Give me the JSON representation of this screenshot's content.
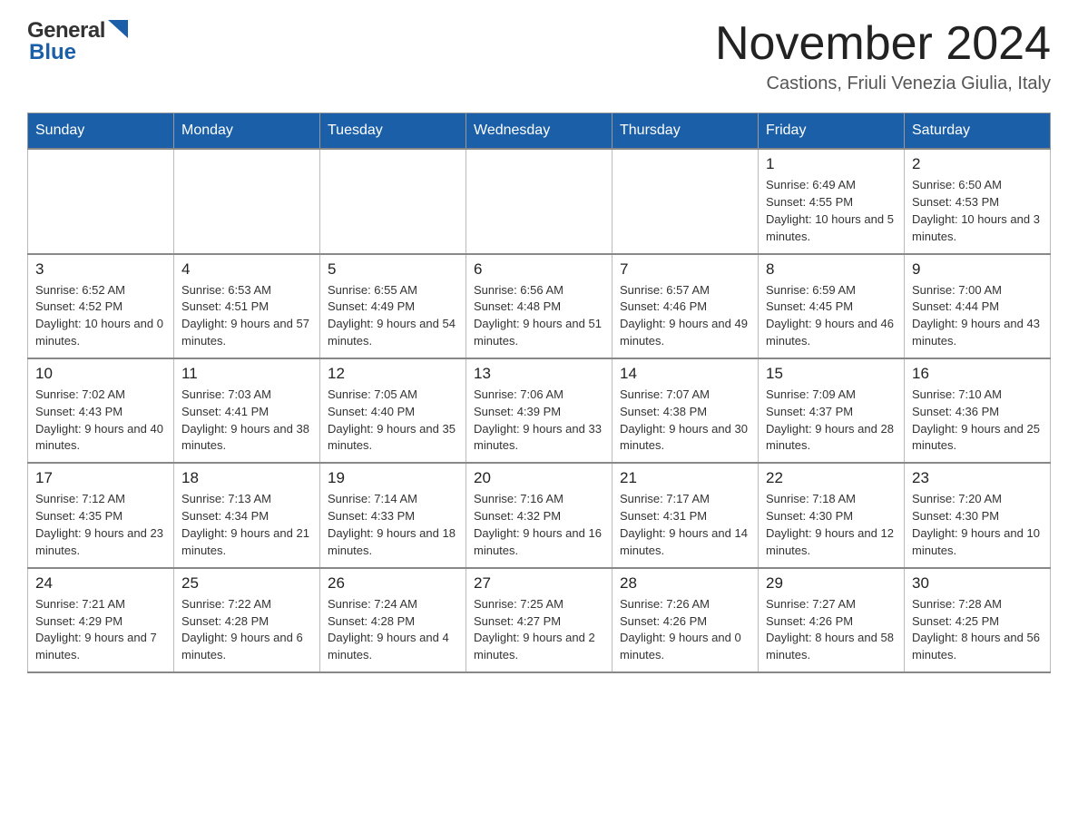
{
  "header": {
    "logo_general": "General",
    "logo_blue": "Blue",
    "month_title": "November 2024",
    "location": "Castions, Friuli Venezia Giulia, Italy"
  },
  "weekdays": [
    "Sunday",
    "Monday",
    "Tuesday",
    "Wednesday",
    "Thursday",
    "Friday",
    "Saturday"
  ],
  "rows": [
    {
      "days": [
        {
          "num": "",
          "info": ""
        },
        {
          "num": "",
          "info": ""
        },
        {
          "num": "",
          "info": ""
        },
        {
          "num": "",
          "info": ""
        },
        {
          "num": "",
          "info": ""
        },
        {
          "num": "1",
          "info": "Sunrise: 6:49 AM\nSunset: 4:55 PM\nDaylight: 10 hours and 5 minutes."
        },
        {
          "num": "2",
          "info": "Sunrise: 6:50 AM\nSunset: 4:53 PM\nDaylight: 10 hours and 3 minutes."
        }
      ]
    },
    {
      "days": [
        {
          "num": "3",
          "info": "Sunrise: 6:52 AM\nSunset: 4:52 PM\nDaylight: 10 hours and 0 minutes."
        },
        {
          "num": "4",
          "info": "Sunrise: 6:53 AM\nSunset: 4:51 PM\nDaylight: 9 hours and 57 minutes."
        },
        {
          "num": "5",
          "info": "Sunrise: 6:55 AM\nSunset: 4:49 PM\nDaylight: 9 hours and 54 minutes."
        },
        {
          "num": "6",
          "info": "Sunrise: 6:56 AM\nSunset: 4:48 PM\nDaylight: 9 hours and 51 minutes."
        },
        {
          "num": "7",
          "info": "Sunrise: 6:57 AM\nSunset: 4:46 PM\nDaylight: 9 hours and 49 minutes."
        },
        {
          "num": "8",
          "info": "Sunrise: 6:59 AM\nSunset: 4:45 PM\nDaylight: 9 hours and 46 minutes."
        },
        {
          "num": "9",
          "info": "Sunrise: 7:00 AM\nSunset: 4:44 PM\nDaylight: 9 hours and 43 minutes."
        }
      ]
    },
    {
      "days": [
        {
          "num": "10",
          "info": "Sunrise: 7:02 AM\nSunset: 4:43 PM\nDaylight: 9 hours and 40 minutes."
        },
        {
          "num": "11",
          "info": "Sunrise: 7:03 AM\nSunset: 4:41 PM\nDaylight: 9 hours and 38 minutes."
        },
        {
          "num": "12",
          "info": "Sunrise: 7:05 AM\nSunset: 4:40 PM\nDaylight: 9 hours and 35 minutes."
        },
        {
          "num": "13",
          "info": "Sunrise: 7:06 AM\nSunset: 4:39 PM\nDaylight: 9 hours and 33 minutes."
        },
        {
          "num": "14",
          "info": "Sunrise: 7:07 AM\nSunset: 4:38 PM\nDaylight: 9 hours and 30 minutes."
        },
        {
          "num": "15",
          "info": "Sunrise: 7:09 AM\nSunset: 4:37 PM\nDaylight: 9 hours and 28 minutes."
        },
        {
          "num": "16",
          "info": "Sunrise: 7:10 AM\nSunset: 4:36 PM\nDaylight: 9 hours and 25 minutes."
        }
      ]
    },
    {
      "days": [
        {
          "num": "17",
          "info": "Sunrise: 7:12 AM\nSunset: 4:35 PM\nDaylight: 9 hours and 23 minutes."
        },
        {
          "num": "18",
          "info": "Sunrise: 7:13 AM\nSunset: 4:34 PM\nDaylight: 9 hours and 21 minutes."
        },
        {
          "num": "19",
          "info": "Sunrise: 7:14 AM\nSunset: 4:33 PM\nDaylight: 9 hours and 18 minutes."
        },
        {
          "num": "20",
          "info": "Sunrise: 7:16 AM\nSunset: 4:32 PM\nDaylight: 9 hours and 16 minutes."
        },
        {
          "num": "21",
          "info": "Sunrise: 7:17 AM\nSunset: 4:31 PM\nDaylight: 9 hours and 14 minutes."
        },
        {
          "num": "22",
          "info": "Sunrise: 7:18 AM\nSunset: 4:30 PM\nDaylight: 9 hours and 12 minutes."
        },
        {
          "num": "23",
          "info": "Sunrise: 7:20 AM\nSunset: 4:30 PM\nDaylight: 9 hours and 10 minutes."
        }
      ]
    },
    {
      "days": [
        {
          "num": "24",
          "info": "Sunrise: 7:21 AM\nSunset: 4:29 PM\nDaylight: 9 hours and 7 minutes."
        },
        {
          "num": "25",
          "info": "Sunrise: 7:22 AM\nSunset: 4:28 PM\nDaylight: 9 hours and 6 minutes."
        },
        {
          "num": "26",
          "info": "Sunrise: 7:24 AM\nSunset: 4:28 PM\nDaylight: 9 hours and 4 minutes."
        },
        {
          "num": "27",
          "info": "Sunrise: 7:25 AM\nSunset: 4:27 PM\nDaylight: 9 hours and 2 minutes."
        },
        {
          "num": "28",
          "info": "Sunrise: 7:26 AM\nSunset: 4:26 PM\nDaylight: 9 hours and 0 minutes."
        },
        {
          "num": "29",
          "info": "Sunrise: 7:27 AM\nSunset: 4:26 PM\nDaylight: 8 hours and 58 minutes."
        },
        {
          "num": "30",
          "info": "Sunrise: 7:28 AM\nSunset: 4:25 PM\nDaylight: 8 hours and 56 minutes."
        }
      ]
    }
  ]
}
